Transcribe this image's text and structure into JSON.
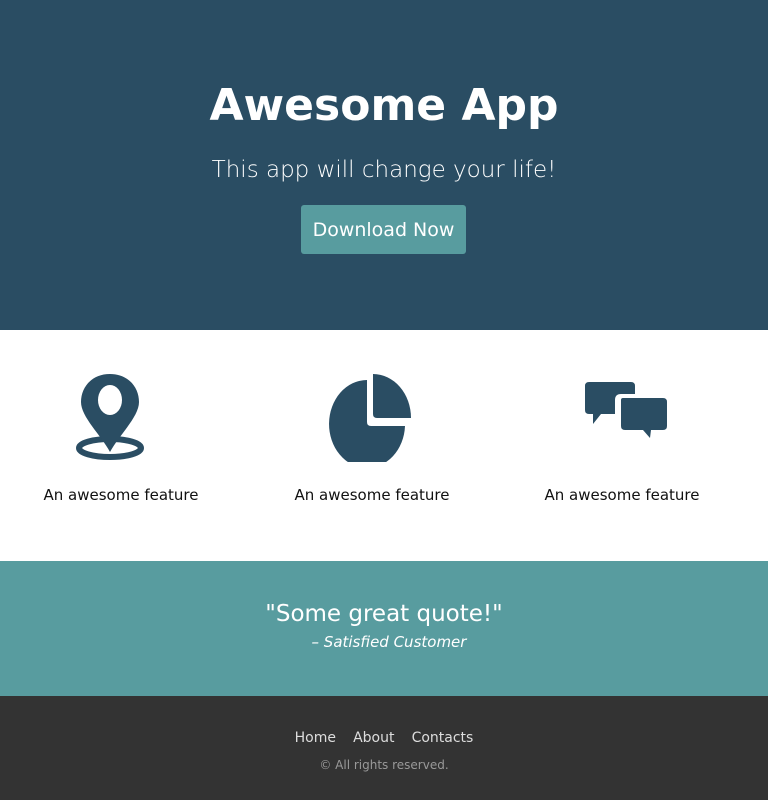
{
  "hero": {
    "title": "Awesome App",
    "subtitle": "This app will change your life!",
    "button": "Download Now"
  },
  "features": [
    {
      "icon": "map-pin-icon",
      "label": "An awesome feature"
    },
    {
      "icon": "pie-chart-icon",
      "label": "An awesome feature"
    },
    {
      "icon": "chat-bubbles-icon",
      "label": "An awesome feature"
    }
  ],
  "quote": {
    "text": "\"Some great quote!\"",
    "author": "– Satisfied Customer"
  },
  "footer": {
    "links": [
      "Home",
      "About",
      "Contacts"
    ],
    "copyright": "© All rights reserved."
  },
  "colors": {
    "primary": "#2a4d63",
    "accent": "#589c9f",
    "footer": "#333333"
  }
}
